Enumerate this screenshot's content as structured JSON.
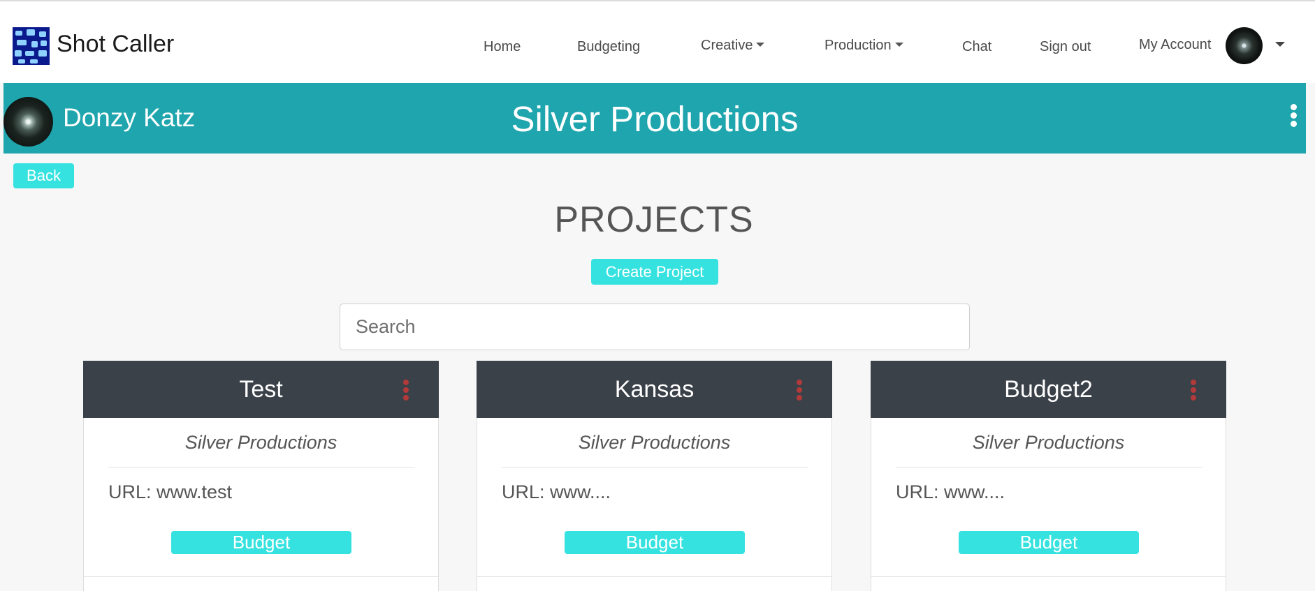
{
  "navbar": {
    "brand": "Shot Caller",
    "items": [
      {
        "label": "Home"
      },
      {
        "label": "Budgeting"
      },
      {
        "label": "Creative"
      },
      {
        "label": "Production"
      },
      {
        "label": "Chat"
      },
      {
        "label": "Sign out"
      },
      {
        "label": "My Account"
      }
    ]
  },
  "banner": {
    "user_name": "Donzy Katz",
    "company": "Silver Productions"
  },
  "back_label": "Back",
  "page": {
    "heading": "PROJECTS",
    "create_label": "Create Project",
    "search_placeholder": "Search"
  },
  "projects": [
    {
      "title": "Test",
      "company": "Silver Productions",
      "url": "URL: www.test",
      "budget_label": "Budget"
    },
    {
      "title": "Kansas",
      "company": "Silver Productions",
      "url": "URL: www....",
      "budget_label": "Budget"
    },
    {
      "title": "Budget2",
      "company": "Silver Productions",
      "url": "URL: www....",
      "budget_label": "Budget"
    }
  ],
  "colors": {
    "accent": "#36e2e0",
    "banner": "#1fa5ad",
    "card_header": "#3a4149",
    "card_menu": "#b23a3a"
  }
}
